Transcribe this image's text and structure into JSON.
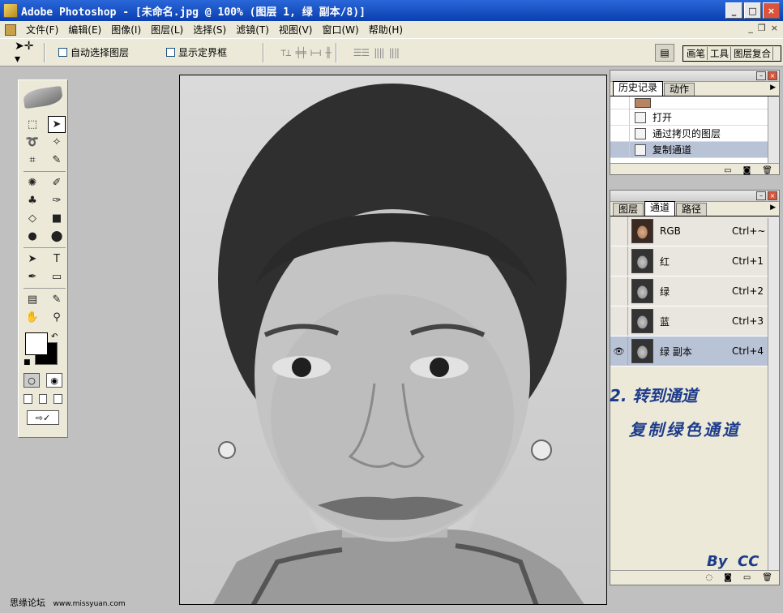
{
  "window": {
    "title": "Adobe Photoshop - [未命名.jpg @ 100% (图层 1, 绿 副本/8)]"
  },
  "menu": [
    "文件(F)",
    "编辑(E)",
    "图像(I)",
    "图层(L)",
    "选择(S)",
    "滤镜(T)",
    "视图(V)",
    "窗口(W)",
    "帮助(H)"
  ],
  "options": {
    "auto_select": "自动选择图层",
    "show_bounds": "显示定界框"
  },
  "palette_well": {
    "tabs": [
      "画笔",
      "工具",
      "图层复合"
    ]
  },
  "history": {
    "tabs": [
      "历史记录",
      "动作"
    ],
    "items": [
      "打开",
      "通过拷贝的图层",
      "复制通道"
    ],
    "selected_index": 2
  },
  "channels": {
    "tabs": [
      "图层",
      "通道",
      "路径"
    ],
    "rows": [
      {
        "name": "RGB",
        "shortcut": "Ctrl+~",
        "visible": false
      },
      {
        "name": "红",
        "shortcut": "Ctrl+1",
        "visible": false
      },
      {
        "name": "绿",
        "shortcut": "Ctrl+2",
        "visible": false
      },
      {
        "name": "蓝",
        "shortcut": "Ctrl+3",
        "visible": false
      },
      {
        "name": "绿 副本",
        "shortcut": "Ctrl+4",
        "visible": true
      }
    ]
  },
  "annotations": {
    "step": "2. 转到通道",
    "detail": "复制绿色通道",
    "author": "By  CC"
  },
  "footer": {
    "site": "思缘论坛",
    "url": "www.missyuan.com"
  },
  "colors": {
    "title_bar": "#0a3fb0",
    "annotation": "#1c3b8a",
    "selection": "#b9c3d6"
  }
}
